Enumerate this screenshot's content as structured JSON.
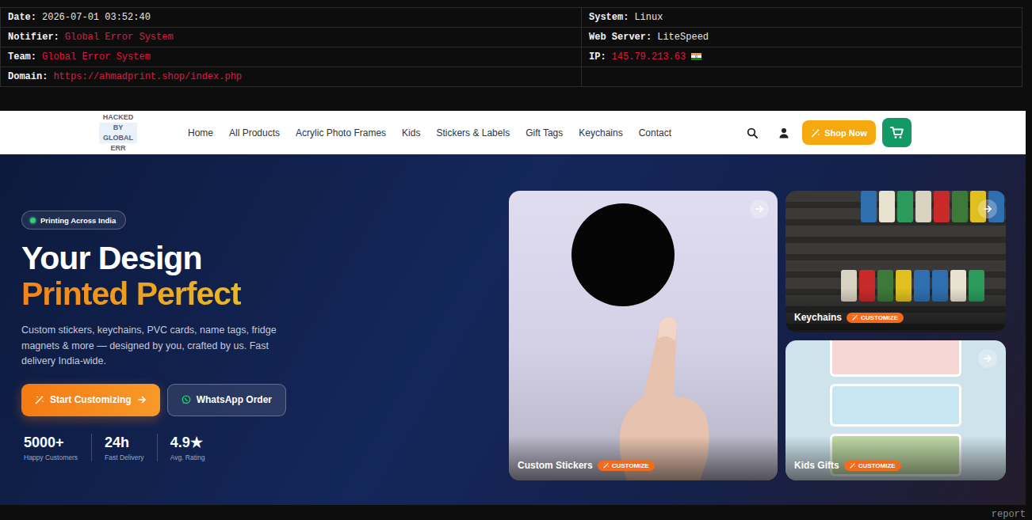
{
  "report": {
    "rows": [
      {
        "cells": [
          {
            "label": "Date:",
            "value": "2026-07-01 03:52:40",
            "kind": "plain"
          },
          {
            "label": "System:",
            "value": "Linux",
            "kind": "plain"
          }
        ]
      },
      {
        "cells": [
          {
            "label": "Notifier:",
            "value": "Global Error System",
            "kind": "accent"
          },
          {
            "label": "Web Server:",
            "value": "LiteSpeed",
            "kind": "plain"
          }
        ]
      },
      {
        "cells": [
          {
            "label": "Team:",
            "value": "Global Error System",
            "kind": "accent"
          },
          {
            "label": "IP:",
            "value": "145.79.213.63",
            "kind": "flag"
          }
        ]
      },
      {
        "cells": [
          {
            "label": "Domain:",
            "value": "https://ahmadprint.shop/index.php",
            "kind": "accent"
          }
        ]
      }
    ]
  },
  "site": {
    "logo": "HACKED BY GLOBAL ERR",
    "nav": [
      {
        "label": "Home",
        "selected": false
      },
      {
        "label": "All Products",
        "selected": false
      },
      {
        "label": "Acrylic Photo Frames",
        "selected": false
      },
      {
        "label": "Kids",
        "selected": false
      },
      {
        "label": "Stickers & Labels",
        "selected": false
      },
      {
        "label": "Gift Tags",
        "selected": false
      },
      {
        "label": "Keychains",
        "selected": false
      },
      {
        "label": "Contact",
        "selected": false
      }
    ],
    "shop_button": "Shop Now",
    "hero": {
      "badge": "Printing Across India",
      "title": "Your Design",
      "subtitle": "Printed Perfect",
      "description": "Custom stickers, keychains, PVC cards, name tags, fridge magnets & more — designed by you, crafted by us. Fast delivery India-wide.",
      "ctas": [
        {
          "label": "Start Customizing",
          "kind": "primary"
        },
        {
          "label": "WhatsApp Order",
          "kind": "secondary"
        }
      ],
      "stats": [
        {
          "value": "5000+",
          "label": "Happy Customers"
        },
        {
          "value": "24h",
          "label": "Fast Delivery"
        },
        {
          "value": "4.9★",
          "label": "Avg. Rating"
        }
      ],
      "cards": [
        {
          "label": "Custom Stickers",
          "badge": "CUSTOMIZE",
          "kind": "stickers"
        },
        {
          "label": "Keychains",
          "badge": "CUSTOMIZE",
          "kind": "keychains"
        },
        {
          "label": "Kids Gifts",
          "badge": "CUSTOMIZE",
          "kind": "kids"
        }
      ]
    }
  },
  "footer": {
    "report": "report"
  }
}
